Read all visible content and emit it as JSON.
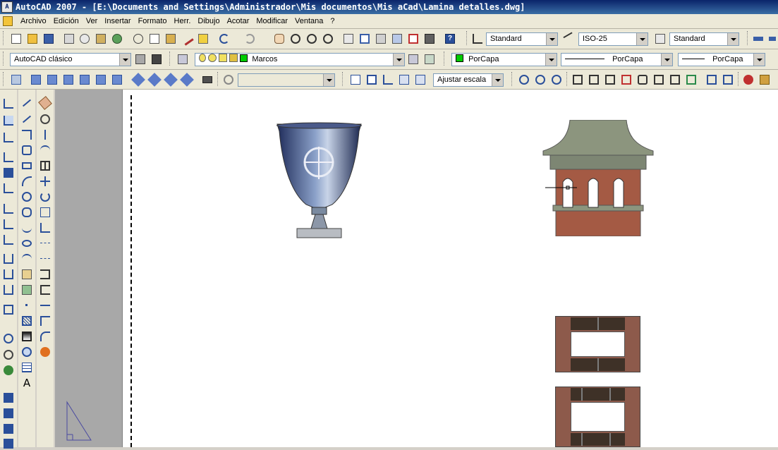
{
  "window": {
    "title": "AutoCAD 2007 - [E:\\Documents and Settings\\Administrador\\Mis documentos\\Mis aCad\\Lamina detalles.dwg]",
    "app_icon_text": "A"
  },
  "menu": [
    "Archivo",
    "Edición",
    "Ver",
    "Insertar",
    "Formato",
    "Herr.",
    "Dibujo",
    "Acotar",
    "Modificar",
    "Ventana",
    "?"
  ],
  "styles_toolbar": {
    "text_style": "Standard",
    "dim_style": "ISO-25",
    "table_style": "Standard"
  },
  "layers_toolbar": {
    "workspace": "AutoCAD clásico",
    "current_layer": "Marcos",
    "color": "PorCapa",
    "linetype": "PorCapa",
    "lineweight": "PorCapa",
    "layer_color": "#00cc00"
  },
  "view_toolbar": {
    "named_view": "",
    "viewport_scale": "Ajustar escala"
  },
  "icons": {
    "top_row": [
      "new-icon",
      "open-icon",
      "save-icon",
      "plot-icon",
      "plot-preview-icon",
      "publish-icon",
      "3d-dwf-icon",
      "cut-icon",
      "copy-icon",
      "paste-icon",
      "match-properties-icon",
      "block-editor-icon",
      "undo-icon",
      "redo-icon",
      "pan-icon",
      "zoom-realtime-icon",
      "zoom-window-icon",
      "zoom-previous-icon",
      "properties-icon",
      "design-center-icon",
      "tool-palettes-icon",
      "sheet-set-icon",
      "markup-icon",
      "quickcalc-icon",
      "help-icon"
    ],
    "draw": [
      "line-icon",
      "construction-line-icon",
      "polyline-icon",
      "polygon-icon",
      "rectangle-icon",
      "arc-icon",
      "circle-icon",
      "revision-cloud-icon",
      "spline-icon",
      "ellipse-icon",
      "ellipse-arc-icon",
      "insert-block-icon",
      "make-block-icon",
      "point-icon",
      "hatch-icon",
      "gradient-icon",
      "region-icon",
      "table-icon",
      "multiline-text-icon"
    ],
    "modify": [
      "erase-icon",
      "copy-object-icon",
      "mirror-icon",
      "offset-icon",
      "array-icon",
      "move-icon",
      "rotate-icon",
      "scale-icon",
      "stretch-icon",
      "trim-icon",
      "extend-icon",
      "break-at-point-icon",
      "break-icon",
      "join-icon",
      "chamfer-icon",
      "fillet-icon",
      "explode-icon"
    ],
    "ucs": [
      "ucs-icon",
      "ucs-world-icon",
      "ucs-previous-icon",
      "ucs-face-icon",
      "ucs-object-icon",
      "ucs-view-icon",
      "ucs-origin-icon",
      "ucs-zaxis-icon",
      "ucs-3point-icon",
      "ucs-x-icon",
      "ucs-y-icon",
      "ucs-z-icon",
      "ucs-apply-icon",
      "orbit-icon",
      "walk-icon",
      "fly-icon",
      "render-icon",
      "lights-icon",
      "materials-icon",
      "wireframe-icon",
      "hidden-icon"
    ]
  },
  "canvas": {
    "background": "#ffffff",
    "sidebar_gray": "#a8a8a8"
  }
}
